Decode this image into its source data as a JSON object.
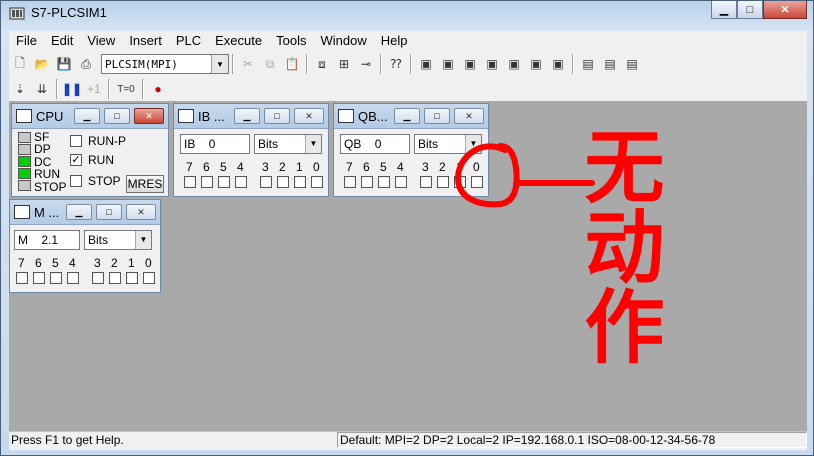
{
  "window": {
    "title": "S7-PLCSIM1"
  },
  "menu": [
    "File",
    "Edit",
    "View",
    "Insert",
    "PLC",
    "Execute",
    "Tools",
    "Window",
    "Help"
  ],
  "toolbar": {
    "access_combo": "PLCSIM(MPI)",
    "step_label": "+1",
    "timer_label": "T=0"
  },
  "cpu_panel": {
    "title": "CPU",
    "leds": [
      {
        "label": "SF",
        "on": false
      },
      {
        "label": "DP",
        "on": false
      },
      {
        "label": "DC",
        "on": true
      },
      {
        "label": "RUN",
        "on": true
      },
      {
        "label": "STOP",
        "on": false
      }
    ],
    "modes": [
      {
        "label": "RUN-P",
        "checked": false
      },
      {
        "label": "RUN",
        "checked": true
      },
      {
        "label": "STOP",
        "checked": false
      }
    ],
    "mres_label": "MRES"
  },
  "ib_panel": {
    "title": "IB ...",
    "area": "IB",
    "address": "0",
    "format": "Bits"
  },
  "qb_panel": {
    "title": "QB...",
    "area": "QB",
    "address": "0",
    "format": "Bits"
  },
  "m_panel": {
    "title": "M ...",
    "area": "M",
    "address": "2.1",
    "format": "Bits"
  },
  "bit_labels": [
    "7",
    "6",
    "5",
    "4",
    "3",
    "2",
    "1",
    "0"
  ],
  "annotation": {
    "text": "无动作",
    "color": "#ff0000"
  },
  "status": {
    "help": "Press F1 to get Help.",
    "connection": "Default:  MPI=2 DP=2 Local=2 IP=192.168.0.1 ISO=08-00-12-34-56-78"
  }
}
